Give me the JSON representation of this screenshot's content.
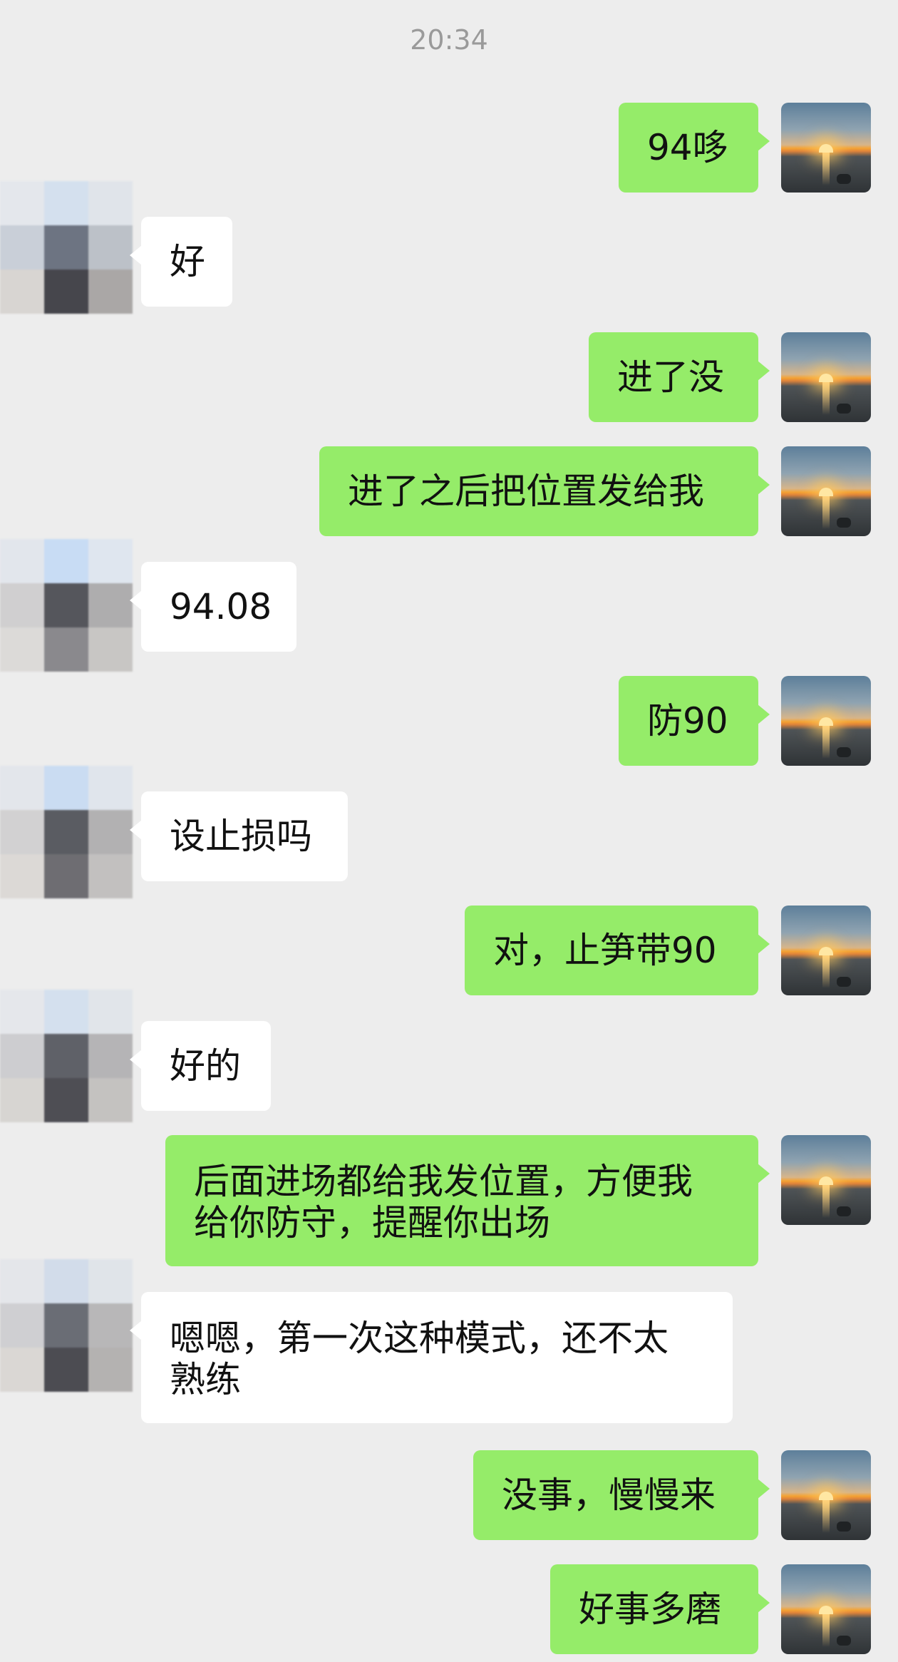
{
  "chat": {
    "timestamp": "20:34",
    "messages": [
      {
        "sender": "me",
        "text": "94哆"
      },
      {
        "sender": "contact",
        "text": "好"
      },
      {
        "sender": "me",
        "text": "进了没"
      },
      {
        "sender": "me",
        "text": "进了之后把位置发给我"
      },
      {
        "sender": "contact",
        "text": "94.08"
      },
      {
        "sender": "me",
        "text": "防90"
      },
      {
        "sender": "contact",
        "text": "设止损吗"
      },
      {
        "sender": "me",
        "text": "对，止笋带90"
      },
      {
        "sender": "contact",
        "text": "好的"
      },
      {
        "sender": "me",
        "text": "后面进场都给我发位置，方便我\n给你防守，提醒你出场"
      },
      {
        "sender": "contact",
        "text": "嗯嗯，第一次这种模式，还不太\n熟练"
      },
      {
        "sender": "me",
        "text": "没事，慢慢来"
      },
      {
        "sender": "me",
        "text": "好事多磨"
      }
    ]
  },
  "colors": {
    "background": "#ededed",
    "my_bubble": "#95ec69",
    "contact_bubble": "#ffffff",
    "timestamp_text": "#9a9a9a"
  },
  "icons": {
    "my_avatar": "sunset-avatar-icon",
    "contact_avatar": "pixelated-avatar-icon"
  }
}
